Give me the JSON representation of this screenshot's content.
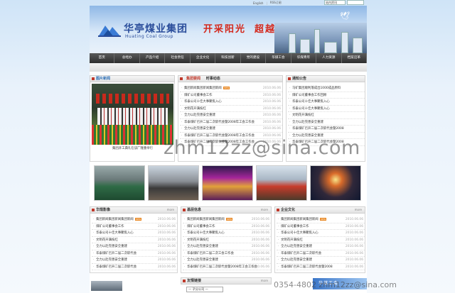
{
  "topbar": {
    "english": "English",
    "rss": "RSS订阅",
    "site_select": "站内资讯"
  },
  "banner": {
    "logo_cn": "华亭煤业集团",
    "logo_en": "Huating Coal Group",
    "slogan_1": "开采阳光",
    "slogan_2": "超越梦想"
  },
  "nav": {
    "items": [
      "首页",
      "总经办",
      "产品介绍",
      "社会责任",
      "企业文化",
      "科技创新",
      "党的建设",
      "华煤工会",
      "华煤青年",
      "人力资源",
      "档案沿革"
    ]
  },
  "photo_news": {
    "title": "图片新闻",
    "caption": "集团开工典礼在该厂隆重举行"
  },
  "group_news": {
    "tabs": [
      "集团要闻",
      "时事动态"
    ],
    "more": "more",
    "items": [
      {
        "text": "集团新闻集团新闻集团新闻",
        "badge": "new",
        "date": "2010.06.06"
      },
      {
        "text": "煤矿公司董事会工作",
        "date": "2010.06.06"
      },
      {
        "text": "华泰公司十佳大事聚焦入心",
        "date": "2010.06.06"
      },
      {
        "text": "文明花开满枝红",
        "date": "2010.06.06"
      },
      {
        "text": "全力以赴完善安全重建",
        "date": "2010.06.06"
      },
      {
        "text": "华泰煤矿召开二届二次职代会暨2008年工会工作会",
        "date": "2010.06.06"
      },
      {
        "text": "全力以赴完善安全重建",
        "date": "2010.06.06"
      },
      {
        "text": "华泰煤矿召开二届二次职代会暨2008年工会工作会",
        "date": "2010.06.06"
      },
      {
        "text": "华泰煤矿召开二届二次职代会暨2008年工会工作会",
        "date": "2010.06.06"
      }
    ]
  },
  "notice": {
    "title": "通知公告",
    "more": "more",
    "items": [
      "马矿集团顺利落成出1000成品原料",
      "煤矿公司董事会工作回顾",
      "华泰公司十佳大事聚焦入心",
      "华泰公司十佳大事聚焦入心",
      "文明花开满枝红",
      "全力以赴完善安全重建",
      "华泰煤矿召开二届二次职代会暨2008",
      "全力以赴完善安全重建",
      "华泰煤矿召开二届二次职代会暨2008"
    ]
  },
  "huamei_video": {
    "title": "华煤影像",
    "more": "more",
    "items": [
      {
        "text": "集团新闻集团新闻集团新闻",
        "badge": "new",
        "date": "2010.06.06"
      },
      {
        "text": "煤矿公司董事会工作",
        "date": "2010.06.06"
      },
      {
        "text": "华泰公司十佳大事聚焦入心",
        "date": "2010.06.06"
      },
      {
        "text": "文明花开满枝红",
        "date": "2010.06.06"
      },
      {
        "text": "全力以赴完善安全重建",
        "date": "2010.06.06"
      },
      {
        "text": "华泰煤矿召开二届二次职代会",
        "date": "2010.06.06"
      },
      {
        "text": "全力以赴完善安全重建",
        "date": "2010.06.06"
      },
      {
        "text": "华泰煤矿召开二届二次职代会",
        "date": "2010.06.06"
      }
    ]
  },
  "grassroots": {
    "title": "基层信息",
    "more": "more",
    "items": [
      {
        "text": "集团新闻集团新闻集团新闻",
        "badge": "new",
        "date": "2010.06.06"
      },
      {
        "text": "煤矿公司董事会工作",
        "date": "2010.06.06"
      },
      {
        "text": "华泰公司十佳大事聚焦入心",
        "date": "2010.06.06"
      },
      {
        "text": "文明花开满枝红",
        "date": "2010.06.06"
      },
      {
        "text": "全力以赴完善安全重建",
        "date": "2010.06.06"
      },
      {
        "text": "华泰煤矿召开二届二次工会工作会",
        "date": "2010.06.06"
      },
      {
        "text": "全力以赴完善安全重建",
        "date": "2010.06.06"
      },
      {
        "text": "华泰煤矿召开二届二次职代会暨2008年工会工作会",
        "date": "2010.06.06"
      }
    ]
  },
  "culture": {
    "title": "企业文化",
    "more": "more",
    "items": [
      {
        "text": "集团新闻集团新闻集团新闻",
        "badge": "new",
        "date": "2010.06.06"
      },
      {
        "text": "煤矿公司董事会工作",
        "date": "2010.06.06"
      },
      {
        "text": "华泰公司十佳大事聚焦入心",
        "date": "2010.06.06"
      },
      {
        "text": "文明花开满枝红",
        "date": "2010.06.06"
      },
      {
        "text": "全力以赴完善安全重建",
        "date": "2010.06.06"
      },
      {
        "text": "华泰煤矿召开二届二次职代会",
        "date": "2010.06.06"
      },
      {
        "text": "全力以赴完善安全重建",
        "date": "2010.06.06"
      },
      {
        "text": "华泰煤矿召开二届二次职代会暨2008",
        "date": "2010.06.06"
      }
    ]
  },
  "links": {
    "title": "友情链接",
    "more": "more",
    "select": "— 子分公司 —"
  },
  "foot_banner": {
    "text": "华煤工会"
  },
  "watermark": {
    "main": "zhm12zz@sina.com",
    "footer": "0354-4802 zhm12zz@sina.com"
  }
}
